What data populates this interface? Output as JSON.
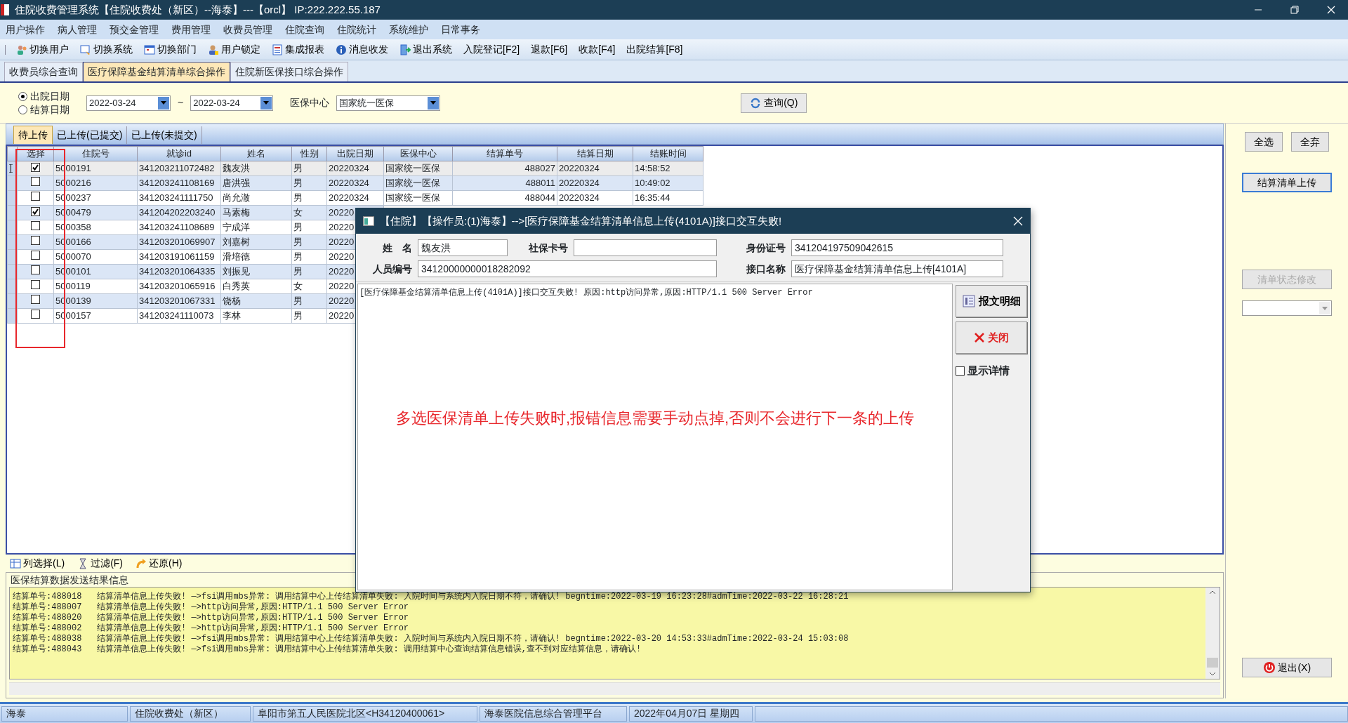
{
  "window": {
    "title": "住院收费管理系统【住院收费处（新区）--海泰】---【orcl】 IP:222.222.55.187"
  },
  "menu": [
    "用户操作",
    "病人管理",
    "预交金管理",
    "费用管理",
    "收费员管理",
    "住院查询",
    "住院统计",
    "系统维护",
    "日常事务"
  ],
  "toolbar": [
    {
      "label": "切换用户",
      "kind": "icon"
    },
    {
      "label": "切换系统",
      "kind": "icon"
    },
    {
      "label": "切换部门",
      "kind": "icon"
    },
    {
      "label": "用户锁定",
      "kind": "icon"
    },
    {
      "label": "集成报表",
      "kind": "icon"
    },
    {
      "label": "消息收发",
      "kind": "icon"
    },
    {
      "label": "退出系统",
      "kind": "icon"
    },
    {
      "label": "入院登记[F2]",
      "kind": "plain"
    },
    {
      "label": "退款[F6]",
      "kind": "plain"
    },
    {
      "label": "收款[F4]",
      "kind": "plain"
    },
    {
      "label": "出院结算[F8]",
      "kind": "plain"
    }
  ],
  "module_tabs": [
    {
      "label": "收费员综合查询",
      "selected": false
    },
    {
      "label": "医疗保障基金结算清单综合操作",
      "selected": true
    },
    {
      "label": "住院新医保接口综合操作",
      "selected": false
    }
  ],
  "filter": {
    "date_type": [
      {
        "label": "出院日期",
        "selected": true
      },
      {
        "label": "结算日期",
        "selected": false
      }
    ],
    "date_from": "2022-03-24",
    "separator": "~",
    "date_to": "2022-03-24",
    "center_label": "医保中心",
    "center_value": "国家统一医保",
    "query_button": "查询(Q)"
  },
  "grid_tabs": [
    {
      "label": "待上传",
      "selected": true
    },
    {
      "label": "已上传(已提交)",
      "selected": false
    },
    {
      "label": "已上传(未提交)",
      "selected": false
    }
  ],
  "table": {
    "columns": [
      "选择",
      "住院号",
      "就诊id",
      "姓名",
      "性别",
      "出院日期",
      "医保中心",
      "结算单号",
      "结算日期",
      "结账时间"
    ],
    "rows": [
      {
        "current": true,
        "checked": true,
        "cells": [
          "",
          "5000191",
          "341203211072482",
          "魏友洪",
          "男",
          "20220324",
          "国家统一医保",
          "488027",
          "20220324",
          "14:58:52"
        ]
      },
      {
        "current": false,
        "checked": false,
        "cells": [
          "",
          "5000216",
          "341203241108169",
          "唐洪强",
          "男",
          "20220324",
          "国家统一医保",
          "488011",
          "20220324",
          "10:49:02"
        ]
      },
      {
        "current": false,
        "checked": false,
        "cells": [
          "",
          "5000237",
          "341203241111750",
          "尚允澈",
          "男",
          "20220324",
          "国家统一医保",
          "488044",
          "20220324",
          "16:35:44"
        ]
      },
      {
        "current": false,
        "checked": true,
        "cells": [
          "",
          "5000479",
          "341204202203240",
          "马素梅",
          "女",
          "20220"
        ]
      },
      {
        "current": false,
        "checked": false,
        "cells": [
          "",
          "5000358",
          "341203241108689",
          "宁成洋",
          "男",
          "20220"
        ]
      },
      {
        "current": false,
        "checked": false,
        "cells": [
          "",
          "5000166",
          "341203201069907",
          "刘嘉树",
          "男",
          "20220"
        ]
      },
      {
        "current": false,
        "checked": false,
        "cells": [
          "",
          "5000070",
          "341203191061159",
          "滑培德",
          "男",
          "20220"
        ]
      },
      {
        "current": false,
        "checked": false,
        "cells": [
          "",
          "5000101",
          "341203201064335",
          "刘振见",
          "男",
          "20220"
        ]
      },
      {
        "current": false,
        "checked": false,
        "cells": [
          "",
          "5000119",
          "341203201065916",
          "白秀英",
          "女",
          "20220"
        ]
      },
      {
        "current": false,
        "checked": false,
        "cells": [
          "",
          "5000139",
          "341203201067331",
          "饶杨",
          "男",
          "20220"
        ]
      },
      {
        "current": false,
        "checked": false,
        "cells": [
          "",
          "5000157",
          "341203241110073",
          "李林",
          "男",
          "20220"
        ]
      }
    ]
  },
  "grid_footer": [
    "列选择(L)",
    "过滤(F)",
    "还原(H)"
  ],
  "log": {
    "title": "医保结算数据发送结果信息",
    "lines": [
      "结算单号:488018   结算清单信息上传失败! —>fsi调用mbs异常: 调用结算中心上传结算清单失败: 入院时间与系统内入院日期不符，请确认! begntime:2022-03-19 16:23:28#admTime:2022-03-22 16:28:21",
      "结算单号:488007   结算清单信息上传失败! —>http访问异常,原因:HTTP/1.1 500 Server Error",
      "结算单号:488020   结算清单信息上传失败! —>http访问异常,原因:HTTP/1.1 500 Server Error",
      "结算单号:488002   结算清单信息上传失败! —>http访问异常,原因:HTTP/1.1 500 Server Error",
      "结算单号:488038   结算清单信息上传失败! —>fsi调用mbs异常: 调用结算中心上传结算清单失败: 入院时间与系统内入院日期不符，请确认! begntime:2022-03-20 14:53:33#admTime:2022-03-24 15:03:08",
      "结算单号:488043   结算清单信息上传失败! —>fsi调用mbs异常: 调用结算中心上传结算清单失败: 调用结算中心查询结算信息错误,查不到对应结算信息，请确认!"
    ]
  },
  "side_buttons": [
    {
      "label": "全选",
      "disabled": false,
      "focused": false
    },
    {
      "label": "全弃",
      "disabled": false,
      "focused": false
    },
    {
      "label": "结算清单上传",
      "disabled": false,
      "focused": true
    },
    {
      "label": "清单状态修改",
      "disabled": true,
      "focused": false
    }
  ],
  "exit_button": "退出(X)",
  "status_bar": [
    "海泰",
    "住院收费处（新区）",
    "阜阳市第五人民医院北区<H34120400061>",
    "海泰医院信息综合管理平台",
    "2022年04月07日 星期四"
  ],
  "dialog": {
    "title": "【住院】【操作员:(1)海泰】-->[医疗保障基金结算清单信息上传(4101A)]接口交互失败!",
    "fields": [
      {
        "label": "姓　名",
        "value": "魏友洪"
      },
      {
        "label": "社保卡号"
      },
      {
        "label": "身份证号",
        "value": "341204197509042615"
      },
      {
        "label": "人员编号",
        "value": "34120000000018282092"
      },
      {
        "label": "接口名称",
        "value": "医疗保障基金结算清单信息上传[4101A]"
      }
    ],
    "message": "[医疗保障基金结算清单信息上传(4101A)]接口交互失败! 原因:http访问异常,原因:HTTP/1.1 500 Server Error",
    "annotation": "多选医保清单上传失败时,报错信息需要手动点掉,否则不会进行下一条的上传",
    "buttons": [
      {
        "label": "报文明细",
        "kind": "detail"
      },
      {
        "label": "关闭",
        "kind": "close"
      }
    ],
    "show_detail": {
      "label": "显示详情",
      "checked": false
    }
  }
}
